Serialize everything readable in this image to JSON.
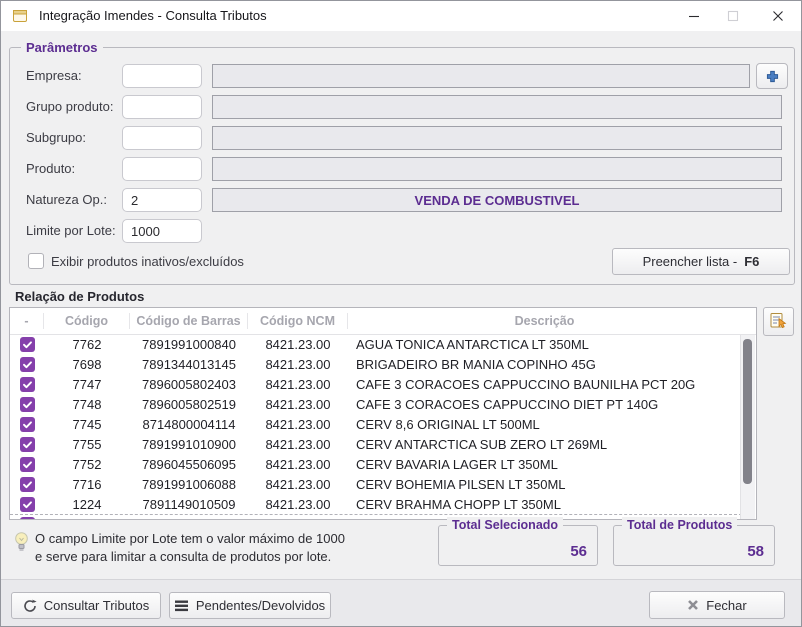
{
  "titlebar": {
    "title": "Integração Imendes - Consulta Tributos"
  },
  "params": {
    "group_label": "Parâmetros",
    "fields": [
      {
        "label": "Empresa:",
        "value": "",
        "detail": ""
      },
      {
        "label": "Grupo produto:",
        "value": "",
        "detail": ""
      },
      {
        "label": "Subgrupo:",
        "value": "",
        "detail": ""
      },
      {
        "label": "Produto:",
        "value": "",
        "detail": ""
      },
      {
        "label": "Natureza Op.:",
        "value": "2",
        "detail": "VENDA DE COMBUSTIVEL"
      },
      {
        "label": "Limite por Lote:",
        "value": "1000"
      }
    ],
    "inactive_checkbox_label": "Exibir produtos inativos/excluídos",
    "inactive_checkbox_checked": false,
    "fill_button": {
      "label": "Preencher lista - ",
      "key": "F6"
    }
  },
  "products": {
    "section_label": "Relação de Produtos",
    "columns": {
      "check": "-",
      "codigo": "Código",
      "barras": "Código de Barras",
      "ncm": "Código NCM",
      "descricao": "Descrição"
    },
    "rows": [
      {
        "checked": true,
        "codigo": "7762",
        "barras": "7891991000840",
        "ncm": "8421.23.00",
        "descricao": "AGUA TONICA ANTARCTICA LT 350ML"
      },
      {
        "checked": true,
        "codigo": "7698",
        "barras": "7891344013145",
        "ncm": "8421.23.00",
        "descricao": "BRIGADEIRO BR MANIA COPINHO 45G"
      },
      {
        "checked": true,
        "codigo": "7747",
        "barras": "7896005802403",
        "ncm": "8421.23.00",
        "descricao": "CAFE 3 CORACOES CAPPUCCINO BAUNILHA PCT 20G"
      },
      {
        "checked": true,
        "codigo": "7748",
        "barras": "7896005802519",
        "ncm": "8421.23.00",
        "descricao": "CAFE 3 CORACOES CAPPUCCINO DIET PT 140G"
      },
      {
        "checked": true,
        "codigo": "7745",
        "barras": "8714800004114",
        "ncm": "8421.23.00",
        "descricao": "CERV 8,6 ORIGINAL LT 500ML"
      },
      {
        "checked": true,
        "codigo": "7755",
        "barras": "7891991010900",
        "ncm": "8421.23.00",
        "descricao": "CERV ANTARCTICA SUB ZERO LT 269ML"
      },
      {
        "checked": true,
        "codigo": "7752",
        "barras": "7896045506095",
        "ncm": "8421.23.00",
        "descricao": "CERV BAVARIA LAGER LT 350ML"
      },
      {
        "checked": true,
        "codigo": "7716",
        "barras": "7891991006088",
        "ncm": "8421.23.00",
        "descricao": "CERV BOHEMIA PILSEN LT 350ML"
      },
      {
        "checked": true,
        "codigo": "1224",
        "barras": "7891149010509",
        "ncm": "8421.23.00",
        "descricao": "CERV BRAHMA CHOPP LT 350ML"
      }
    ]
  },
  "footer": {
    "hint_line1": "O campo Limite por Lote tem o valor máximo de 1000",
    "hint_line2": "e serve para limitar a consulta de produtos por lote.",
    "total_selected": {
      "label": "Total Selecionado",
      "value": "56"
    },
    "total_products": {
      "label": "Total de Produtos",
      "value": "58"
    }
  },
  "actions": {
    "consult": "Consultar Tributos",
    "pending": "Pendentes/Devolvidos",
    "close": "Fechar"
  },
  "colors": {
    "accent_purple": "#5c2d91",
    "checkbox_purple": "#8540ab",
    "plus_blue": "#4a7ec2"
  }
}
